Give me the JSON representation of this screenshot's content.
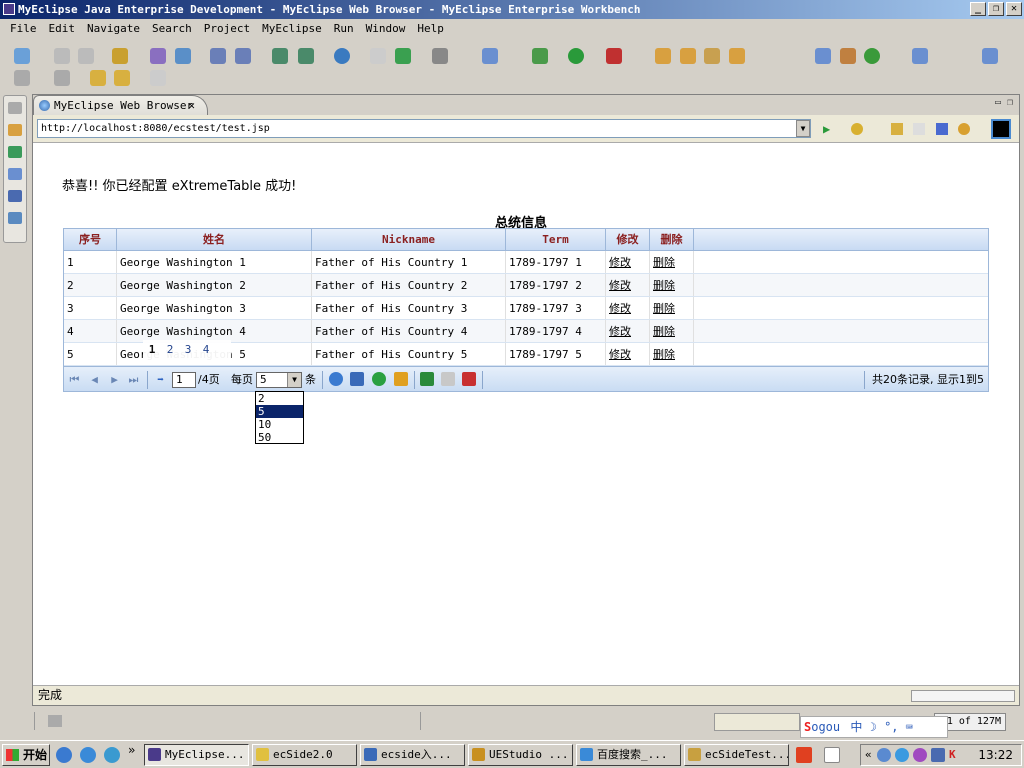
{
  "window": {
    "title": "MyEclipse Java Enterprise Development - MyEclipse Web Browser - MyEclipse Enterprise Workbench"
  },
  "menubar": [
    "File",
    "Edit",
    "Navigate",
    "Search",
    "Project",
    "MyEclipse",
    "Run",
    "Window",
    "Help"
  ],
  "editor_tab": {
    "label": "MyEclipse Web Browser"
  },
  "browser": {
    "url": "http://localhost:8080/ecstest/test.jsp",
    "status": "完成"
  },
  "page": {
    "congrats": "恭喜!! 你已经配置 eXtremeTable 成功!",
    "caption": "总统信息",
    "columns": [
      "序号",
      "姓名",
      "Nickname",
      "Term",
      "修改",
      "删除"
    ],
    "rows": [
      {
        "no": "1",
        "name": "George Washington 1",
        "nick": "Father of His Country 1",
        "term": "1789-1797 1",
        "edit": "修改",
        "del": "删除"
      },
      {
        "no": "2",
        "name": "George Washington 2",
        "nick": "Father of His Country 2",
        "term": "1789-1797 2",
        "edit": "修改",
        "del": "删除"
      },
      {
        "no": "3",
        "name": "George Washington 3",
        "nick": "Father of His Country 3",
        "term": "1789-1797 3",
        "edit": "修改",
        "del": "删除"
      },
      {
        "no": "4",
        "name": "George Washington 4",
        "nick": "Father of His Country 4",
        "term": "1789-1797 4",
        "edit": "修改",
        "del": "删除"
      },
      {
        "no": "5",
        "name": "George Washington 5",
        "nick": "Father of His Country 5",
        "term": "1789-1797 5",
        "edit": "修改",
        "del": "删除"
      }
    ],
    "pager": {
      "current_page": "1",
      "total_pages": "/4页",
      "per_page_label": "每页",
      "per_page_value": "5",
      "per_page_unit": "条",
      "per_page_options": [
        "2",
        "5",
        "10",
        "50"
      ],
      "summary": "共20条记录, 显示1到5",
      "quick_pages": [
        "1",
        "2",
        "3",
        "4"
      ]
    }
  },
  "workbench_status": {
    "memory": "1 of 127M"
  },
  "ime": {
    "logo_s": "S",
    "logo_rest": "ogou",
    "mode": "中"
  },
  "taskbar": {
    "start": "开始",
    "tasks": [
      "MyEclipse...",
      "ecSide2.0",
      "ecside入...",
      "UEStudio ...",
      "百度搜索_...",
      "ecSideTest..."
    ],
    "clock": "13:22"
  },
  "colors": {
    "accent": "#0a246a",
    "header_text": "#8b2020",
    "grid_border": "#9db7d9"
  }
}
